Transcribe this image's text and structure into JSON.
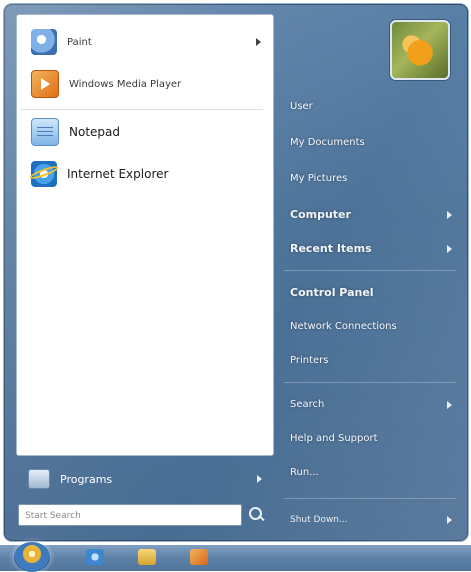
{
  "left_pane": {
    "items": [
      {
        "label": "Paint",
        "icon": "paint-icon",
        "has_submenu": true
      },
      {
        "label": "Windows Media Player",
        "icon": "media-player-icon",
        "has_submenu": false
      },
      {
        "label": "Notepad",
        "icon": "notepad-icon",
        "has_submenu": false
      },
      {
        "label": "Internet Explorer",
        "icon": "internet-explorer-icon",
        "has_submenu": false
      }
    ]
  },
  "programs": {
    "label": "Programs",
    "icon": "programs-icon"
  },
  "search": {
    "placeholder": "Start Search"
  },
  "right_pane": {
    "items": [
      {
        "label": "User",
        "bold": false,
        "submenu": false
      },
      {
        "label": "My Documents",
        "bold": false,
        "submenu": false
      },
      {
        "label": "My Pictures",
        "bold": false,
        "submenu": false
      },
      {
        "label": "Computer",
        "bold": true,
        "submenu": true
      },
      {
        "label": "Recent Items",
        "bold": true,
        "submenu": true
      },
      {
        "label": "Control Panel",
        "bold": true,
        "submenu": false
      },
      {
        "label": "Network Connections",
        "bold": false,
        "submenu": false
      },
      {
        "label": "Printers",
        "bold": false,
        "submenu": false
      },
      {
        "label": "Search",
        "bold": false,
        "submenu": true
      },
      {
        "label": "Help and Support",
        "bold": false,
        "submenu": false
      },
      {
        "label": "Run...",
        "bold": false,
        "submenu": false
      }
    ],
    "shutdown_label": "Shut Down..."
  },
  "colors": {
    "menu_blue": "#4d7399",
    "left_pane_bg": "#ffffff",
    "taskbar": "#5f82a8"
  }
}
